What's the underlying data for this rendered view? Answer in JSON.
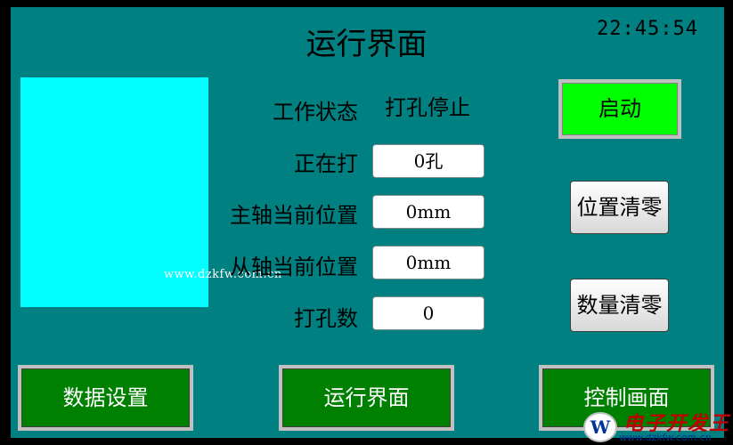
{
  "header": {
    "title": "运行界面",
    "clock": "22:45:54"
  },
  "watermark": "www.dzkfw.com.cn",
  "status": {
    "label": "工作状态",
    "value": "打孔停止"
  },
  "fields": [
    {
      "label": "正在打",
      "value": "0孔"
    },
    {
      "label": "主轴当前位置",
      "value": "0mm"
    },
    {
      "label": "从轴当前位置",
      "value": "0mm"
    },
    {
      "label": "打孔数",
      "value": "0"
    }
  ],
  "buttons": {
    "start": "启动",
    "reset_position": "位置清零",
    "reset_count": "数量清零"
  },
  "nav": {
    "data_settings": "数据设置",
    "run_screen": "运行界面",
    "control_screen": "控制画面"
  },
  "logo": {
    "text": "电子开发王",
    "url": "www.dzkfw.com.cn",
    "icon": "w-logo-icon"
  },
  "colors": {
    "background": "#008080",
    "start_button": "#00ff00",
    "nav_button": "#008000",
    "panel": "#00ffff"
  }
}
